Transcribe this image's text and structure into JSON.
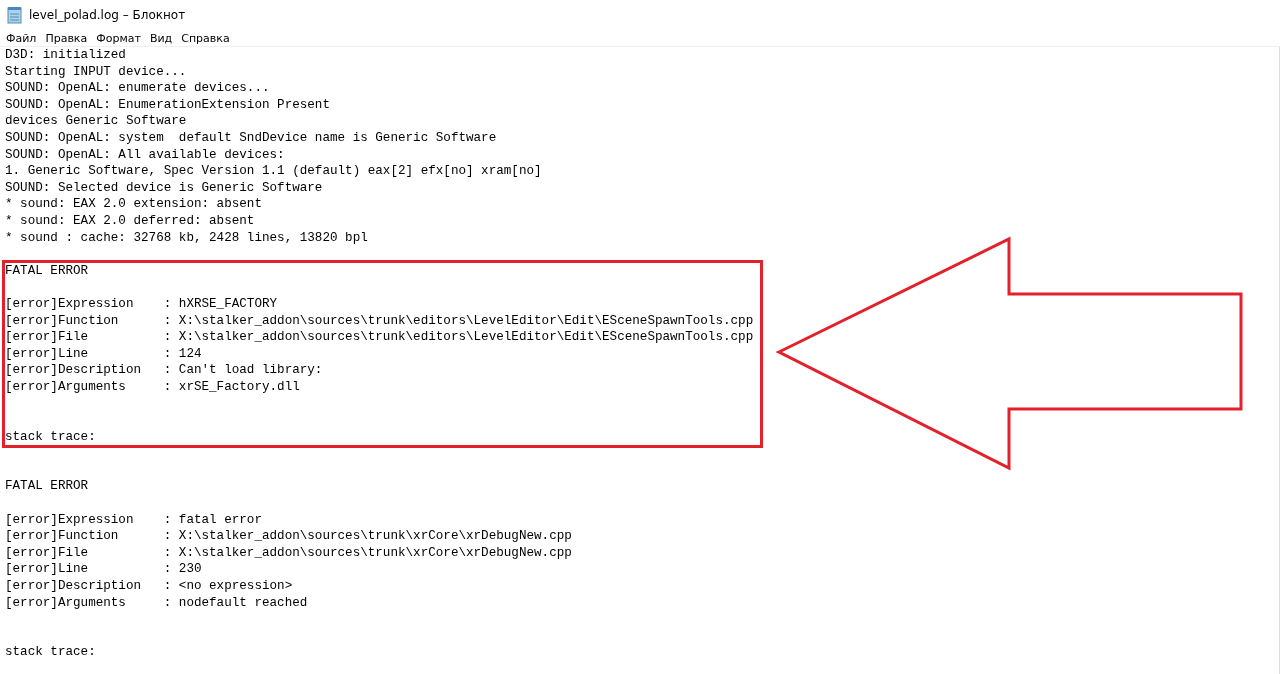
{
  "window": {
    "title": "level_polad.log – Блокнот"
  },
  "menu": [
    "Файл",
    "Правка",
    "Формат",
    "Вид",
    "Справка"
  ],
  "log_lines": [
    "D3D: initialized",
    "Starting INPUT device...",
    "SOUND: OpenAL: enumerate devices...",
    "SOUND: OpenAL: EnumerationExtension Present",
    "devices Generic Software",
    "SOUND: OpenAL: system  default SndDevice name is Generic Software",
    "SOUND: OpenAL: All available devices:",
    "1. Generic Software, Spec Version 1.1 (default) eax[2] efx[no] xram[no]",
    "SOUND: Selected device is Generic Software",
    "* sound: EAX 2.0 extension: absent",
    "* sound: EAX 2.0 deferred: absent",
    "* sound : cache: 32768 kb, 2428 lines, 13820 bpl"
  ],
  "reports": [
    {
      "title": "FATAL ERROR",
      "highlighted": true,
      "lines": [
        "[error]Expression    : hXRSE_FACTORY",
        "[error]Function      : X:\\stalker_addon\\sources\\trunk\\editors\\LevelEditor\\Edit\\ESceneSpawnTools.cpp",
        "[error]File          : X:\\stalker_addon\\sources\\trunk\\editors\\LevelEditor\\Edit\\ESceneSpawnTools.cpp",
        "[error]Line          : 124",
        "[error]Description   : Can't load library:",
        "[error]Arguments     : xrSE_Factory.dll"
      ],
      "footer": "stack trace:"
    },
    {
      "title": "FATAL ERROR",
      "highlighted": false,
      "lines": [
        "[error]Expression    : fatal error",
        "[error]Function      : X:\\stalker_addon\\sources\\trunk\\xrCore\\xrDebugNew.cpp",
        "[error]File          : X:\\stalker_addon\\sources\\trunk\\xrCore\\xrDebugNew.cpp",
        "[error]Line          : 230",
        "[error]Description   : <no expression>",
        "[error]Arguments     : nodefault reached"
      ],
      "footer": "stack trace:"
    }
  ]
}
